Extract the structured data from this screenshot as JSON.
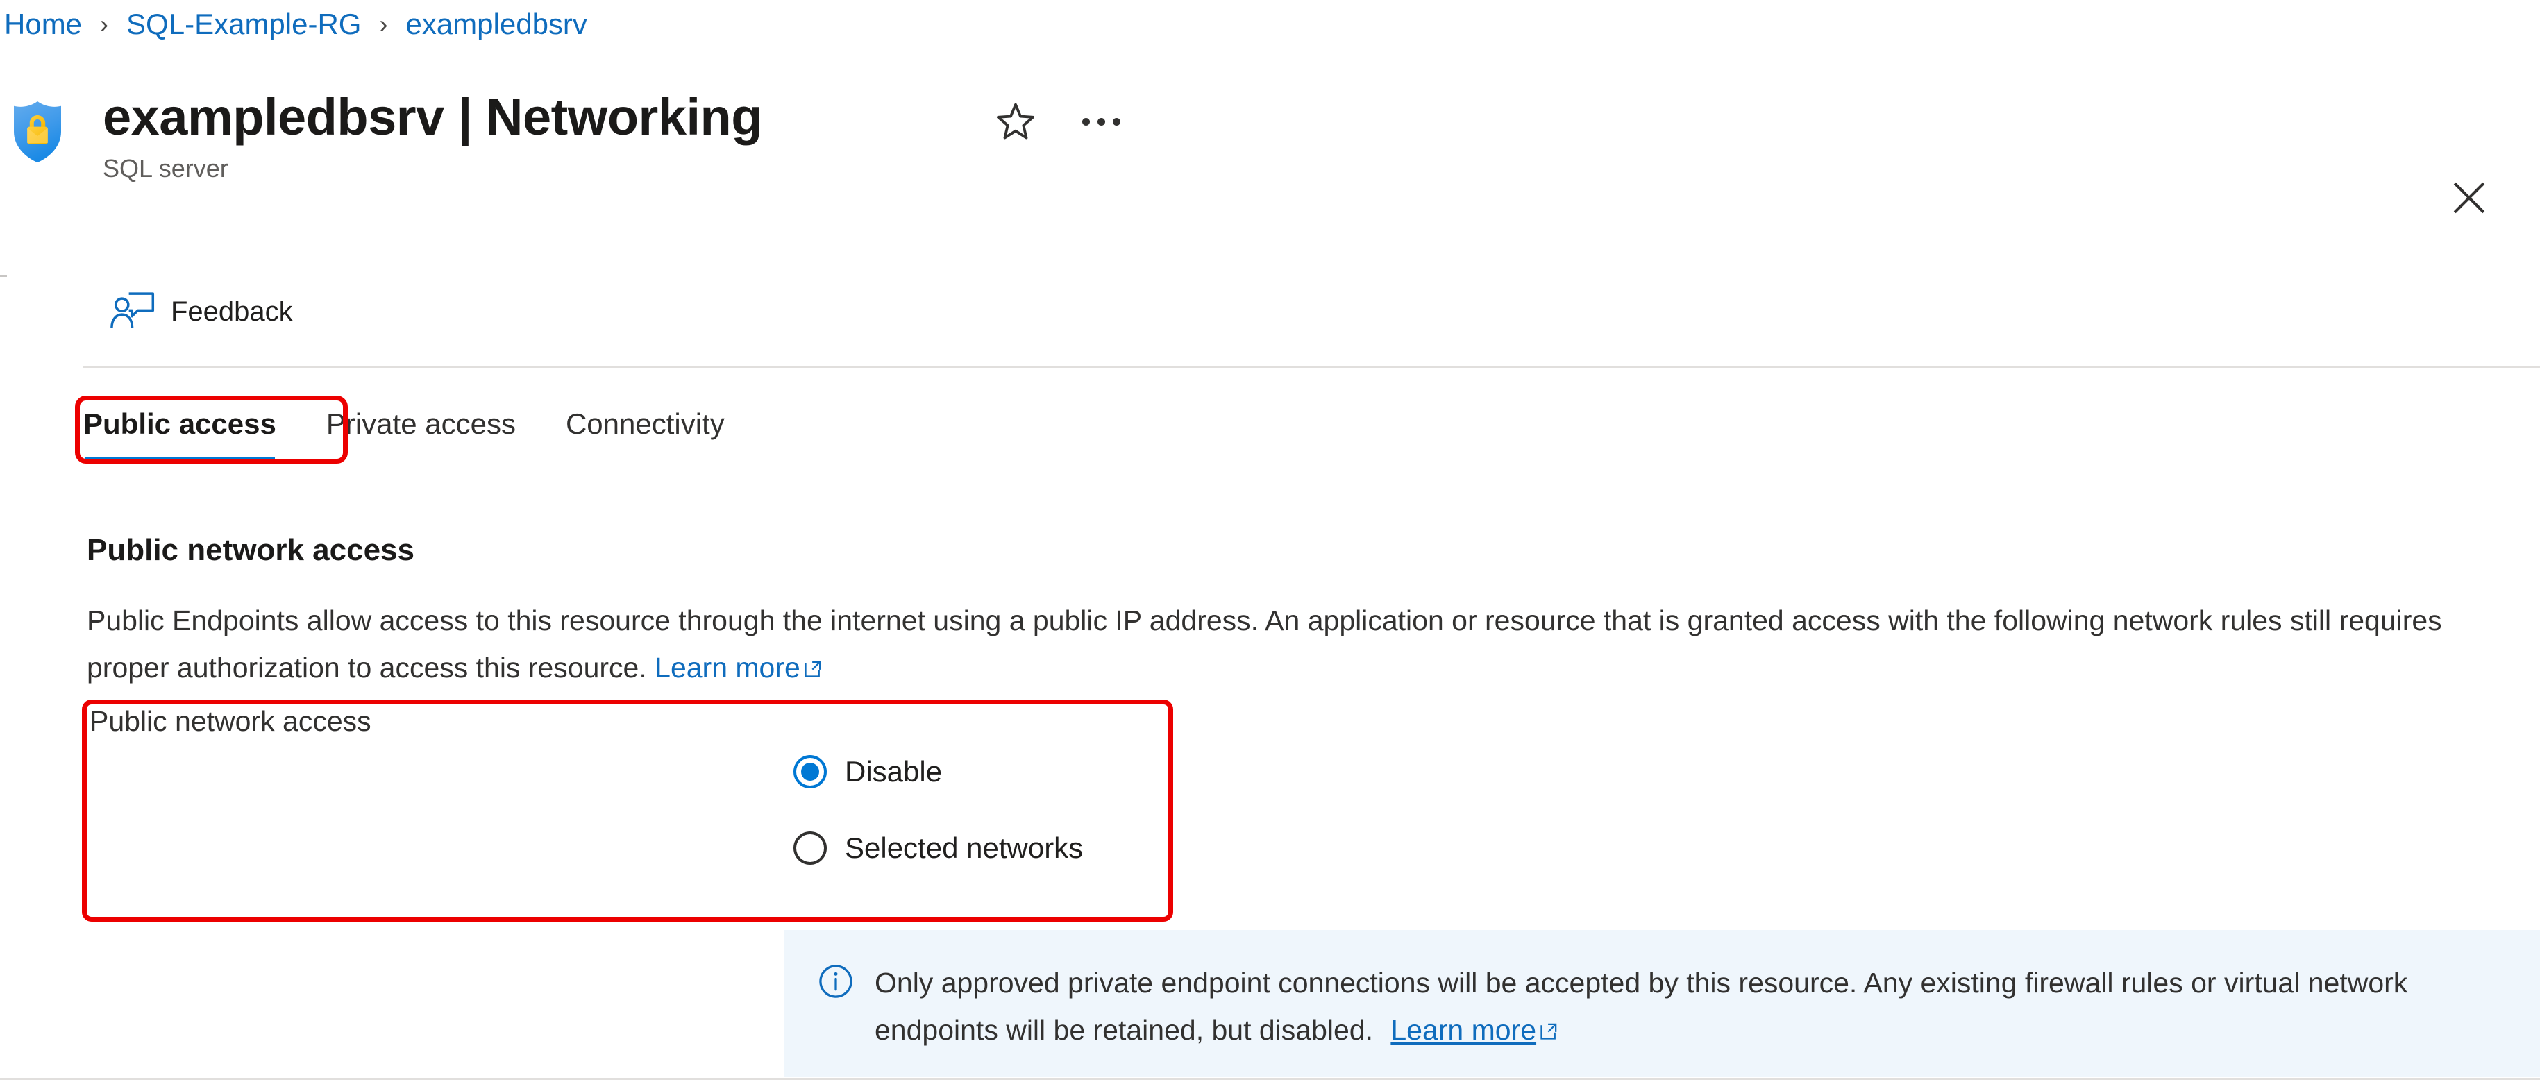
{
  "breadcrumb": {
    "items": [
      {
        "label": "Home"
      },
      {
        "label": "SQL-Example-RG"
      },
      {
        "label": "exampledbsrv"
      }
    ],
    "separator": "›"
  },
  "header": {
    "title": "exampledbsrv | Networking",
    "subtitle": "SQL server",
    "resource_icon": "sql-server-shield-lock-icon",
    "favorite_icon": "star-outline-icon",
    "more_icon": "ellipsis-icon",
    "close_icon": "close-icon"
  },
  "command_bar": {
    "feedback_label": "Feedback",
    "feedback_icon": "person-feedback-icon"
  },
  "tabs": [
    {
      "label": "Public access",
      "active": true
    },
    {
      "label": "Private access",
      "active": false
    },
    {
      "label": "Connectivity",
      "active": false
    }
  ],
  "section": {
    "heading": "Public network access",
    "description_part1": "Public Endpoints allow access to this resource through the internet using a public IP address. An application or resource that is granted access with the following network rules still requires proper authorization to access this resource. ",
    "learn_more_label": "Learn more",
    "external_link_icon": "external-link-icon"
  },
  "form": {
    "label": "Public network access",
    "options": [
      {
        "label": "Disable",
        "selected": true
      },
      {
        "label": "Selected networks",
        "selected": false
      }
    ]
  },
  "info_banner": {
    "icon": "info-circle-icon",
    "text": "Only approved private endpoint connections will be accepted by this resource. Any existing firewall rules or virtual network endpoints will be retained, but disabled. ",
    "learn_more_label": "Learn more",
    "external_link_icon": "external-link-icon",
    "background_color": "#eff6fc"
  },
  "annotations": {
    "color": "#ec0000",
    "boxes": [
      {
        "target": "tab-public-access"
      },
      {
        "target": "public-network-access-form-row"
      }
    ]
  },
  "colors": {
    "accent": "#0078d4",
    "link": "#0f6cbd",
    "text": "#323130",
    "title": "#1b1a19",
    "subtle": "#605e5c",
    "divider": "#e1dfdd",
    "annotation": "#ec0000"
  }
}
